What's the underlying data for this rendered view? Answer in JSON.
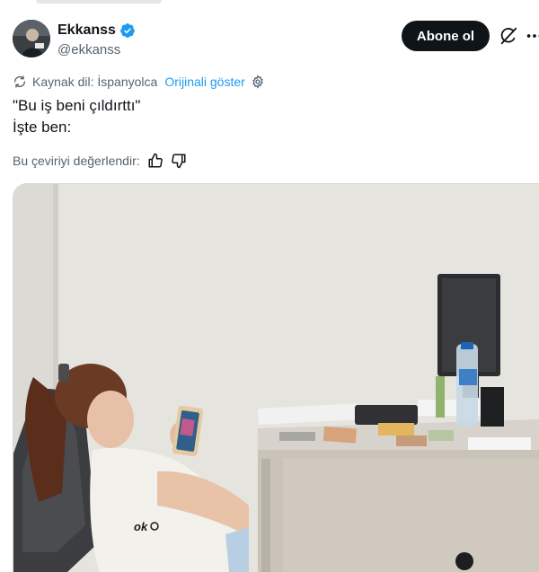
{
  "post": {
    "author": {
      "display_name": "Ekkanss",
      "handle": "@ekkanss",
      "verified": true
    },
    "follow_label": "Abone ol",
    "translation": {
      "source_label": "Kaynak dil: İspanyolca",
      "show_original": "Orijinali göster"
    },
    "text_lines": [
      "\"Bu iş beni çıldırttı\"",
      "İşte ben:"
    ],
    "rate_label": "Bu çeviriyi değerlendir:",
    "media": {
      "shirt_text": "ok"
    }
  },
  "colors": {
    "accent": "#1d9bf0",
    "text_primary": "#0f1419",
    "text_secondary": "#536471",
    "follow_bg": "#0f1419"
  },
  "icons": [
    "verified-badge-icon",
    "grok-icon",
    "more-icon",
    "translate-icon",
    "gear-icon",
    "thumbs-up-icon",
    "thumbs-down-icon"
  ]
}
